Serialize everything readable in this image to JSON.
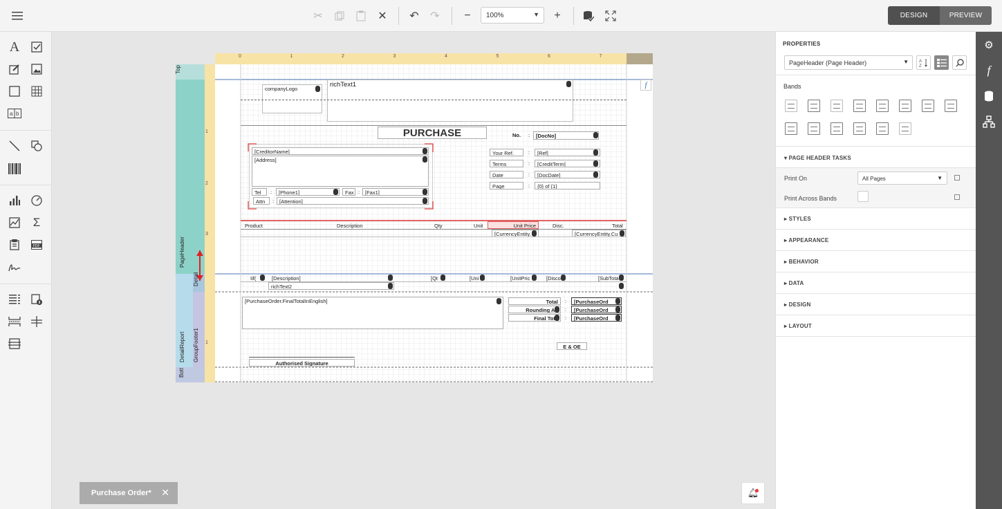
{
  "toolbar": {
    "zoom_value": "100%",
    "design_label": "DESIGN",
    "preview_label": "PREVIEW"
  },
  "properties": {
    "title": "PROPERTIES",
    "selected_component": "PageHeader (Page Header)",
    "bands_label": "Bands",
    "tasks_header": "PAGE HEADER TASKS",
    "print_on_label": "Print On",
    "print_on_value": "All Pages",
    "print_across_label": "Print Across Bands",
    "sections": [
      "STYLES",
      "APPEARANCE",
      "BEHAVIOR",
      "DATA",
      "DESIGN",
      "LAYOUT"
    ]
  },
  "report": {
    "ruler_numbers": [
      "0",
      "1",
      "2",
      "3",
      "4",
      "5",
      "6",
      "7"
    ],
    "vruler_numbers": [
      "1",
      "2",
      "3",
      "1"
    ],
    "band_labels": {
      "top": "Top",
      "page_header": "PageHeader",
      "detail": "Detail",
      "detail_report": "DetailReport",
      "group_footer": "GroupFooter1",
      "bottom": "Bott"
    },
    "company_logo": "companyLogo",
    "rich_text1": "richText1",
    "title": "PURCHASE",
    "no_label": "No.",
    "colon": ":",
    "doc_no": "[DocNo]",
    "creditor_name": "[CreditorName]",
    "address": "[Address]",
    "tel_label": "Tel",
    "phone": "[Phone1]",
    "fax_label": "Fax",
    "fax": "[Fax1]",
    "attn_label": "Attn",
    "attention": "[Attention]",
    "your_ref_label": "Your Ref.",
    "ref": "[Ref]",
    "terms_label": "Terms",
    "credit_term": "[CreditTerm]",
    "date_label": "Date",
    "doc_date": "[DocDate]",
    "page_label": "Page",
    "page_value": "{0} of {1}",
    "col_product": "Product",
    "col_description": "Description",
    "col_qty": "Qty",
    "col_unit": "Unit",
    "col_unit_price": "Unit Price",
    "col_disc": "Disc.",
    "col_total": "Total",
    "currency1": "[CurrencyEntity.",
    "currency2": "[CurrencyEntity.Cu",
    "detail_iif": "Iif(",
    "detail_desc": "[Description]",
    "detail_qty": "[Qt",
    "detail_unit": "[Uni",
    "detail_unit_price": "[UnitPric",
    "detail_disc": "[Disco",
    "detail_subtotal": "[SubTota",
    "rich_text2": "richText2",
    "final_total_english": "[PurchaseOrder.FinalTotalInEnglish]",
    "total_label": "Total",
    "rounding_label": "Rounding Ad",
    "final_total_label": "Final Tota",
    "purchase_ord": "[PurchaseOrd",
    "eoe": "E & OE",
    "signature": "Authorised Signature"
  },
  "tab": {
    "label": "Purchase Order*"
  }
}
